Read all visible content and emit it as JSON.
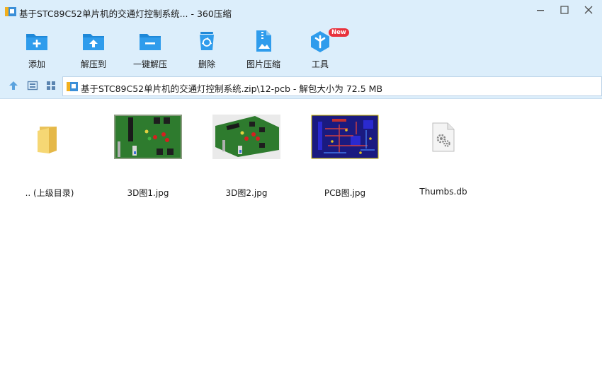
{
  "window": {
    "title": "基于STC89C52单片机的交通灯控制系统... - 360压缩"
  },
  "toolbar": {
    "items": [
      {
        "label": "添加",
        "icon": "add-folder-icon"
      },
      {
        "label": "解压到",
        "icon": "extract-to-folder-icon"
      },
      {
        "label": "一键解压",
        "icon": "one-click-extract-icon"
      },
      {
        "label": "删除",
        "icon": "recycle-bin-icon"
      },
      {
        "label": "图片压缩",
        "icon": "image-compress-icon"
      },
      {
        "label": "工具",
        "icon": "tools-icon",
        "badge": "New"
      }
    ]
  },
  "address": {
    "path": "基于STC89C52单片机的交通灯控制系统.zip\\12-pcb - 解包大小为 72.5 MB"
  },
  "files": [
    {
      "name": ".. (上级目录)",
      "icon": "parent-folder-icon"
    },
    {
      "name": "3D图1.jpg",
      "icon": "pcb-3d-thumbnail"
    },
    {
      "name": "3D图2.jpg",
      "icon": "pcb-3d-thumbnail"
    },
    {
      "name": "PCB图.jpg",
      "icon": "pcb-layout-thumbnail"
    },
    {
      "name": "Thumbs.db",
      "icon": "system-file-gear-icon"
    }
  ],
  "colors": {
    "chrome": "#dceefb",
    "accent": "#1e88d8",
    "badge": "#e8323c"
  }
}
